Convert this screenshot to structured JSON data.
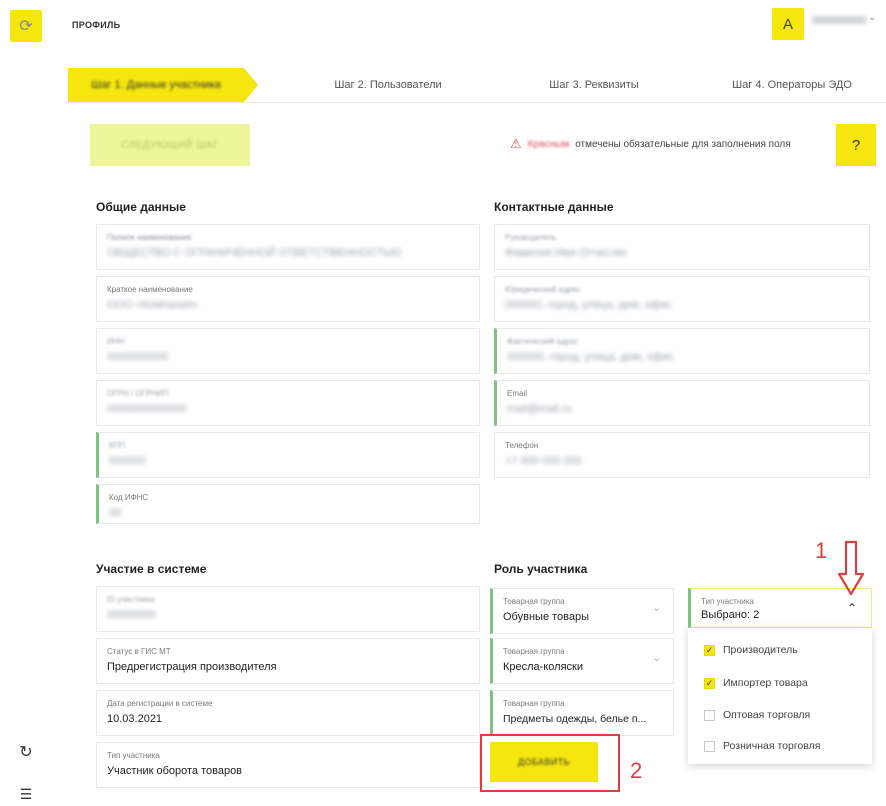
{
  "header": {
    "page_title": "ПРОФИЛЬ",
    "avatar_letter": "A",
    "user_name": "пользователь"
  },
  "steps": [
    {
      "label": "Шаг 1. Данные участника",
      "active": true
    },
    {
      "label": "Шаг 2. Пользователи",
      "active": false
    },
    {
      "label": "Шаг 3. Реквизиты",
      "active": false
    },
    {
      "label": "Шаг 4. Операторы ЭДО",
      "active": false
    }
  ],
  "toolbar": {
    "next_label": "СЛЕДУЮЩИЙ ШАГ",
    "required_red": "Красным",
    "required_rest": "отмечены обязательные для заполнения поля",
    "help_glyph": "?"
  },
  "general": {
    "title": "Общие данные",
    "fields": [
      {
        "label": "Полное наименование",
        "value": "ОБЩЕСТВО С ОГРАНИЧЕННОЙ ОТВЕТСТВЕННОСТЬЮ"
      },
      {
        "label": "Краткое наименование",
        "value": "ООО «Компания»"
      },
      {
        "label": "ИНН",
        "value": "0000000000"
      },
      {
        "label": "ОГРН / ОГРНИП",
        "value": "0000000000000"
      },
      {
        "label": "КПП",
        "value": "000000"
      },
      {
        "label": "Код ИФНС",
        "value": "00"
      }
    ]
  },
  "contacts": {
    "title": "Контактные данные",
    "fields": [
      {
        "label": "Руководитель",
        "value": "Фамилия Имя Отчество"
      },
      {
        "label": "Юридический адрес",
        "value": "000000, город, улица, дом, офис"
      },
      {
        "label": "Фактический адрес",
        "value": "000000, город, улица, дом, офис"
      },
      {
        "label": "Email",
        "value": "mail@mail.ru"
      },
      {
        "label": "Телефон",
        "value": "+7 000 000 000"
      }
    ]
  },
  "participation": {
    "title": "Участие в системе",
    "fields": [
      {
        "label": "ID участника",
        "value": "00000000"
      },
      {
        "label": "Статус в ГИС МТ",
        "value": "Предрегистрация производителя"
      },
      {
        "label": "Дата регистрации в системе",
        "value": "10.03.2021"
      },
      {
        "label": "Тип участника",
        "value": "Участник оборота товаров"
      }
    ]
  },
  "role": {
    "title": "Роль участника",
    "groups": [
      {
        "label": "Товарная группа",
        "value": "Обувные товары"
      },
      {
        "label": "Товарная группа",
        "value": "Кресла-коляски"
      },
      {
        "label": "Товарная группа",
        "value": "Предметы одежды, белье п..."
      }
    ],
    "type_label": "Тип участника",
    "type_value": "Выбрано: 2",
    "options": [
      {
        "label": "Производитель",
        "checked": true
      },
      {
        "label": "Импортер товара",
        "checked": true
      },
      {
        "label": "Оптовая торговля",
        "checked": false
      },
      {
        "label": "Розничная торговля",
        "checked": false
      }
    ],
    "add_label": "ДОБАВИТЬ"
  },
  "annotations": {
    "one": "1",
    "two": "2"
  },
  "colors": {
    "accent": "#f5e70d",
    "required": "#7cc47f",
    "annotation": "#d94040"
  }
}
